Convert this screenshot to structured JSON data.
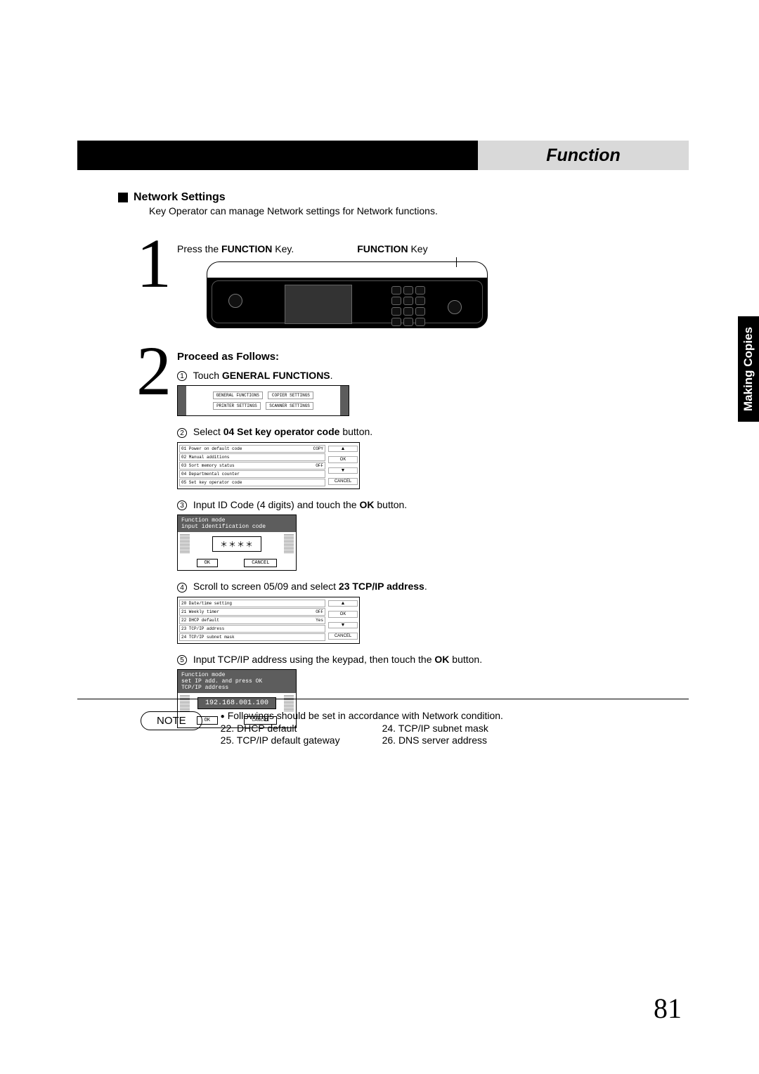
{
  "header": {
    "title": "Function"
  },
  "side_tab": "Making Copies",
  "section": {
    "title": "Network Settings",
    "desc": "Key Operator can manage Network settings for Network functions."
  },
  "step1": {
    "press": "Press the ",
    "press_bold": "FUNCTION",
    "press_tail": " Key.",
    "callout_bold": "FUNCTION",
    "callout_tail": " Key"
  },
  "step2": {
    "heading": "Proceed as Follows:",
    "s1": {
      "pre": "Touch ",
      "bold": "GENERAL FUNCTIONS",
      "post": ".",
      "mini_btns": [
        "GENERAL FUNCTIONS",
        "COPIER SETTINGS",
        "PRINTER SETTINGS",
        "SCANNER SETTINGS"
      ]
    },
    "s2": {
      "pre": "Select ",
      "bold": "04 Set key operator code",
      "post": " button.",
      "rows": [
        {
          "l": "01 Power on default code",
          "r": "COPY"
        },
        {
          "l": "02 Manual additions",
          "r": ""
        },
        {
          "l": "03 Sort memory status",
          "r": "OFF"
        },
        {
          "l": "04 Departmental counter",
          "r": ""
        },
        {
          "l": "05 Set key operator code",
          "r": ""
        }
      ],
      "ok": "OK",
      "cancel": "CANCEL"
    },
    "s3": {
      "pre": "Input ID Code (4 digits) and touch the ",
      "bold": "OK",
      "post": " button.",
      "lcd_top1": "Function mode",
      "lcd_top2": "input identification code",
      "lcd_field": "＊＊＊＊",
      "ok": "OK",
      "cancel": "CANCEL"
    },
    "s4": {
      "pre": "Scroll to screen 05/09 and select ",
      "bold": "23 TCP/IP address",
      "post": ".",
      "rows": [
        {
          "l": "20 Date/time setting",
          "r": ""
        },
        {
          "l": "21 Weekly timer",
          "r": "OFF"
        },
        {
          "l": "22 DHCP default",
          "r": "Yes"
        },
        {
          "l": "23 TCP/IP address",
          "r": ""
        },
        {
          "l": "24 TCP/IP subnet mask",
          "r": ""
        }
      ],
      "ok": "OK",
      "cancel": "CANCEL"
    },
    "s5": {
      "pre": "Input TCP/IP address using the keypad, then touch the ",
      "bold": "OK",
      "post": " button.",
      "lcd_top1": "Function mode",
      "lcd_top2": "set IP add. and press OK",
      "lcd_top3": "TCP/IP address",
      "lcd_field": "192.168.001.100",
      "ok": "OK",
      "cancel": "CANCEL"
    }
  },
  "note": {
    "label": "NOTE",
    "lead": "Followings should be set in accordance with Network condition.",
    "items_left": [
      "22. DHCP default",
      "25. TCP/IP default gateway"
    ],
    "items_right": [
      "24. TCP/IP subnet mask",
      "26. DNS server address"
    ]
  },
  "page_number": "81"
}
